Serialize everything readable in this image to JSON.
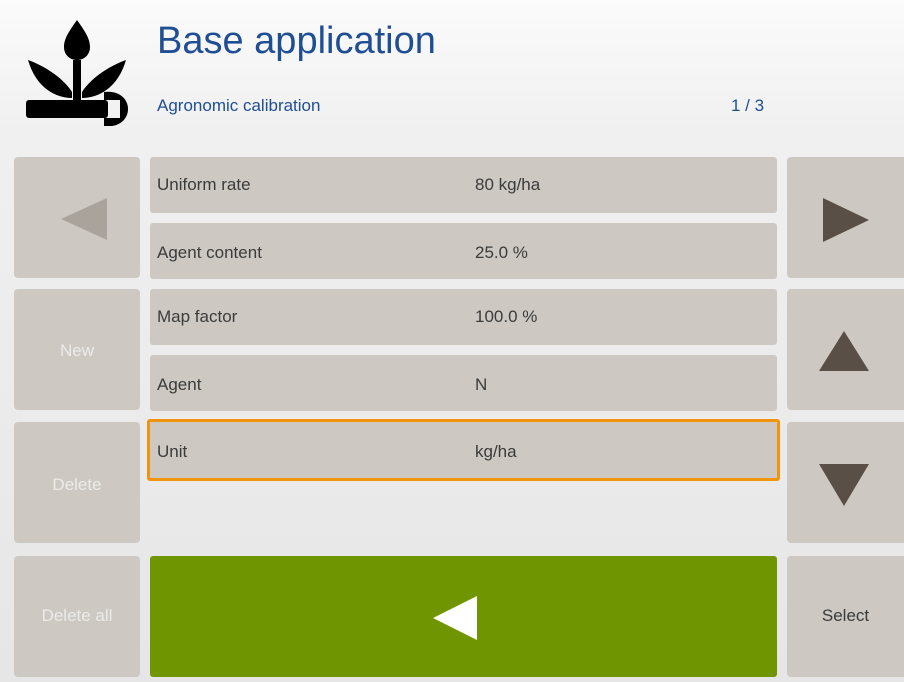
{
  "header": {
    "title": "Base application",
    "subtitle": "Agronomic calibration",
    "page_indicator": "1 / 3"
  },
  "left_buttons": {
    "new_label": "New",
    "delete_label": "Delete",
    "delete_all_label": "Delete all"
  },
  "right_buttons": {
    "select_label": "Select"
  },
  "rows": [
    {
      "label": "Uniform rate",
      "value": "80 kg/ha"
    },
    {
      "label": "Agent content",
      "value": "25.0 %"
    },
    {
      "label": "Map factor",
      "value": "100.0 %"
    },
    {
      "label": "Agent",
      "value": "N"
    },
    {
      "label": "Unit",
      "value": "kg/ha",
      "selected": true
    }
  ],
  "icons": {
    "logo": "plant-wrench-icon",
    "prev": "triangle-left-icon",
    "next": "triangle-right-icon",
    "up": "triangle-up-icon",
    "down": "triangle-down-icon",
    "back": "back-arrow-icon"
  },
  "colors": {
    "title": "#1f4e94",
    "button_bg": "#cdc8c2",
    "ok_green": "#6f9600",
    "selection_orange": "#f0940c",
    "arrow_dark": "#5a4f47",
    "arrow_disabled": "#aaa39c"
  }
}
